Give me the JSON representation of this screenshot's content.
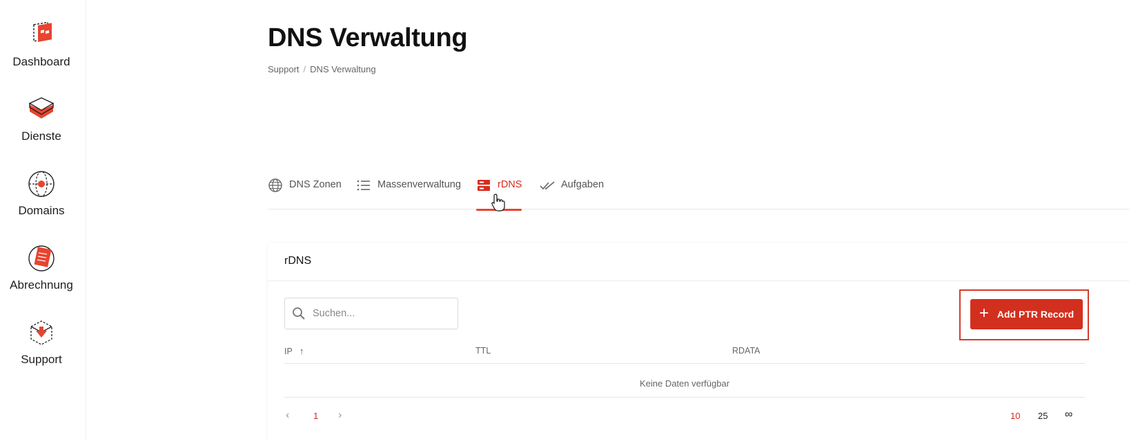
{
  "sidebar": {
    "items": [
      {
        "label": "Dashboard",
        "icon": "dashboard-icon"
      },
      {
        "label": "Dienste",
        "icon": "services-icon"
      },
      {
        "label": "Domains",
        "icon": "globe-icon"
      },
      {
        "label": "Abrechnung",
        "icon": "billing-icon"
      },
      {
        "label": "Support",
        "icon": "support-icon"
      }
    ]
  },
  "header": {
    "title": "DNS Verwaltung",
    "breadcrumb": [
      "Support",
      "DNS Verwaltung"
    ]
  },
  "tabs": [
    {
      "label": "DNS Zonen",
      "icon": "globe-icon",
      "active": false
    },
    {
      "label": "Massenverwaltung",
      "icon": "list-icon",
      "active": false
    },
    {
      "label": "rDNS",
      "icon": "server-icon",
      "active": true
    },
    {
      "label": "Aufgaben",
      "icon": "double-check-icon",
      "active": false
    }
  ],
  "card": {
    "title": "rDNS",
    "search_placeholder": "Suchen...",
    "search_value": "",
    "add_button_label": "Add PTR Record",
    "columns": [
      "IP",
      "TTL",
      "RDATA"
    ],
    "sort_indicator": "↑",
    "empty_text": "Keine Daten verfügbar",
    "pagination": {
      "prev": "‹",
      "next": "›",
      "current_page": "1",
      "page_sizes": [
        "10",
        "25",
        "∞"
      ],
      "active_size": "10"
    }
  },
  "colors": {
    "accent": "#d32f1e",
    "tab_underline": "#e8442f"
  }
}
